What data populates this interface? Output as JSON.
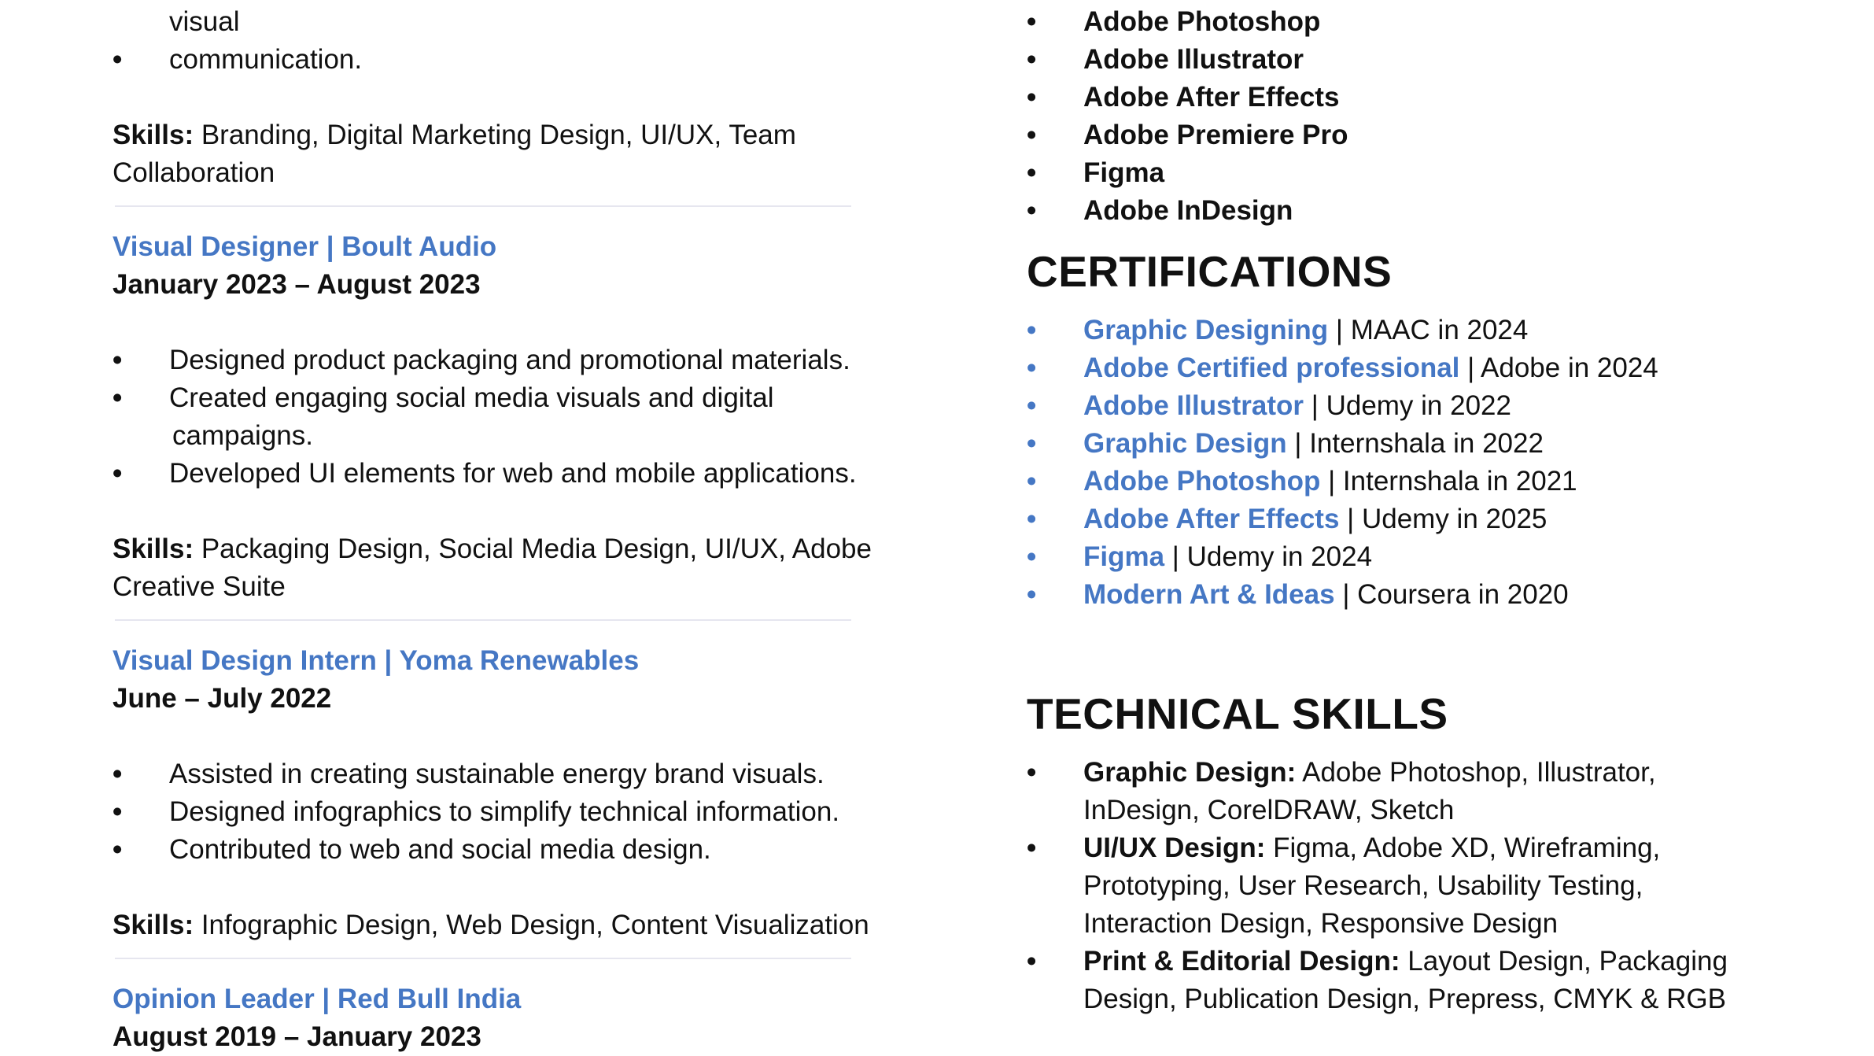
{
  "left": {
    "top_lines": [
      "visual",
      "communication."
    ],
    "job0_skills": {
      "label": "Skills:",
      "text": " Branding, Digital Marketing Design, UI/UX, Team",
      "cont": "Collaboration"
    },
    "job1": {
      "title": "Visual Designer | Boult Audio",
      "date": "January 2023 – August 2023",
      "bullets": [
        "Designed product packaging and promotional materials.",
        "Created engaging social media visuals and digital",
        "Developed UI elements for web and mobile applications."
      ],
      "bullet1_cont": "campaigns.",
      "skills": {
        "label": "Skills:",
        "text": " Packaging Design, Social Media Design, UI/UX, Adobe",
        "cont": "Creative Suite"
      }
    },
    "job2": {
      "title": "Visual Design Intern | Yoma Renewables",
      "date": "June – July 2022",
      "bullets": [
        "Assisted in creating sustainable energy brand visuals.",
        "Designed infographics to simplify technical information.",
        "Contributed to web and social media design."
      ],
      "skills": {
        "label": "Skills:",
        "text": " Infographic Design, Web Design, Content Visualization"
      }
    },
    "job3": {
      "title": "Opinion Leader | Red Bull India",
      "date": "August 2019 – January 2023"
    }
  },
  "right": {
    "software": [
      "Adobe Photoshop",
      "Adobe Illustrator",
      "Adobe After Effects",
      "Adobe Premiere Pro",
      "Figma",
      "Adobe InDesign"
    ],
    "certifications_heading": "CERTIFICATIONS",
    "certifications": [
      {
        "name": "Graphic Designing",
        "detail": " | MAAC in 2024"
      },
      {
        "name": "Adobe Certified professional",
        "detail": " | Adobe in 2024"
      },
      {
        "name": "Adobe Illustrator",
        "detail": " | Udemy in 2022"
      },
      {
        "name": "Graphic Design",
        "detail": " | Internshala in 2022"
      },
      {
        "name": "Adobe Photoshop",
        "detail": " | Internshala in 2021"
      },
      {
        "name": "Adobe After Effects",
        "detail": " | Udemy in 2025"
      },
      {
        "name": "Figma",
        "detail": " | Udemy in 2024"
      },
      {
        "name": "Modern Art & Ideas",
        "detail": " | Coursera in 2020"
      }
    ],
    "technical_heading": "TECHNICAL SKILLS",
    "technical": [
      {
        "label": "Graphic Design:",
        "lines": [
          " Adobe Photoshop, Illustrator,",
          "InDesign, CorelDRAW, Sketch"
        ]
      },
      {
        "label": "UI/UX Design:",
        "lines": [
          " Figma, Adobe XD, Wireframing,",
          "Prototyping, User Research, Usability Testing,",
          "Interaction Design, Responsive Design"
        ]
      },
      {
        "label": "Print & Editorial Design:",
        "lines": [
          " Layout Design, Packaging",
          "Design, Publication Design, Prepress, CMYK & RGB"
        ]
      }
    ],
    "bullet_char": "•",
    "colors": {
      "accent": "#4577c4",
      "text": "#111111",
      "rule": "#e6e6ef"
    }
  }
}
